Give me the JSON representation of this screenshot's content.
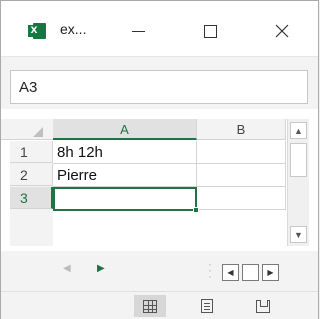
{
  "window": {
    "title": "ex...",
    "app_icon_letter": "X",
    "icons": {
      "app": "excel-icon",
      "minimize": "minimize-icon",
      "maximize": "maximize-icon",
      "close": "close-icon"
    }
  },
  "name_box": {
    "value": "A3"
  },
  "grid": {
    "columns": [
      "A",
      "B"
    ],
    "rows": [
      "1",
      "2",
      "3"
    ],
    "cells": [
      [
        "8h 12h",
        ""
      ],
      [
        "Pierre",
        ""
      ],
      [
        "",
        ""
      ]
    ],
    "selected_cell": "A3"
  },
  "colors": {
    "accent": "#217346",
    "header_bg": "#f3f3f3",
    "selected_header_bg": "#e1e1e1"
  },
  "status_bar": {
    "views": [
      "Normal",
      "Page Layout",
      "Page Break Preview"
    ],
    "active_view": "Normal"
  }
}
